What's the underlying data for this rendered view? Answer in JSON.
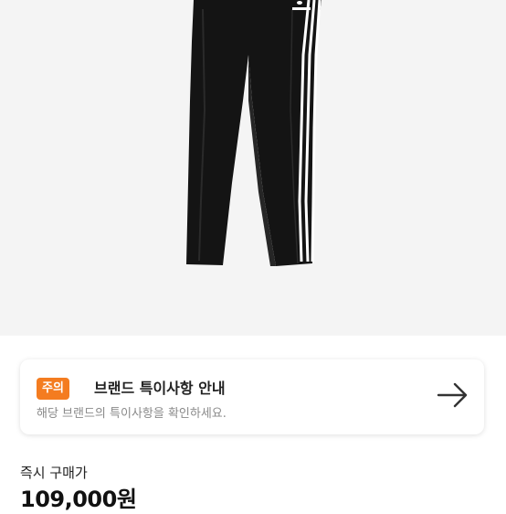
{
  "product": {
    "image_name": "black-track-pants-image",
    "logo_alt": "adidas trefoil logo"
  },
  "notice": {
    "badge": "주의",
    "title": "브랜드 특이사항 안내",
    "subtitle": "해당 브랜드의 특이사항을 확인하세요.",
    "arrow_icon": "arrow-right-icon"
  },
  "price": {
    "label": "즉시 구매가",
    "value": "109,000원"
  },
  "colors": {
    "badge": "#f47c20",
    "image_bg": "#f4f4f4",
    "pants": "#141414",
    "stripe": "#ffffff"
  }
}
